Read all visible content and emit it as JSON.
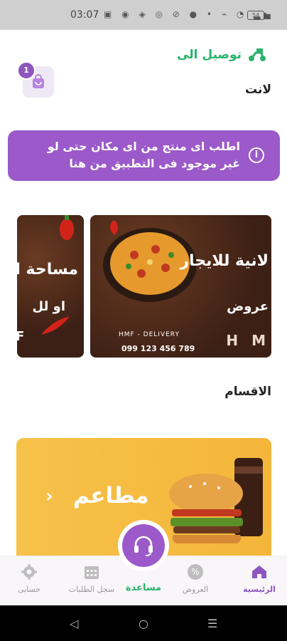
{
  "status_bar": {
    "time": "03:07",
    "icons": "▣ ◉ ◈ ◎ ⊘ ● • ⌁ ◔ ▂▄ ",
    "battery": "54"
  },
  "header": {
    "deliver_to_label": "توصيل الى",
    "location_name": "لانت",
    "cart_count": "1"
  },
  "notice": {
    "text": "اطلب اى منتج من اى مكان حتى لو غير موجود فى التطبيق من هنا",
    "icon": "info-icon"
  },
  "slides": [
    {
      "headline": "مساحة اع",
      "sub": "او لل",
      "letter": "F"
    },
    {
      "headline": "لانية للايجار",
      "sub": "عروض",
      "brand": "HMF - DELIVERY",
      "phone": "099 123 456 789",
      "letters": "H M"
    }
  ],
  "sections": {
    "categories_title": "الاقسام"
  },
  "categories": [
    {
      "name": "مطاعم",
      "arrow": "›"
    }
  ],
  "bottom_nav": {
    "home": "الرئيسية",
    "offers": "العروض",
    "help": "مساعدة",
    "history": "سجل الطلبات",
    "account": "حسابى"
  },
  "colors": {
    "accent": "#9b59c9",
    "green": "#29b36b",
    "card_yellow": "#f6bd45"
  }
}
